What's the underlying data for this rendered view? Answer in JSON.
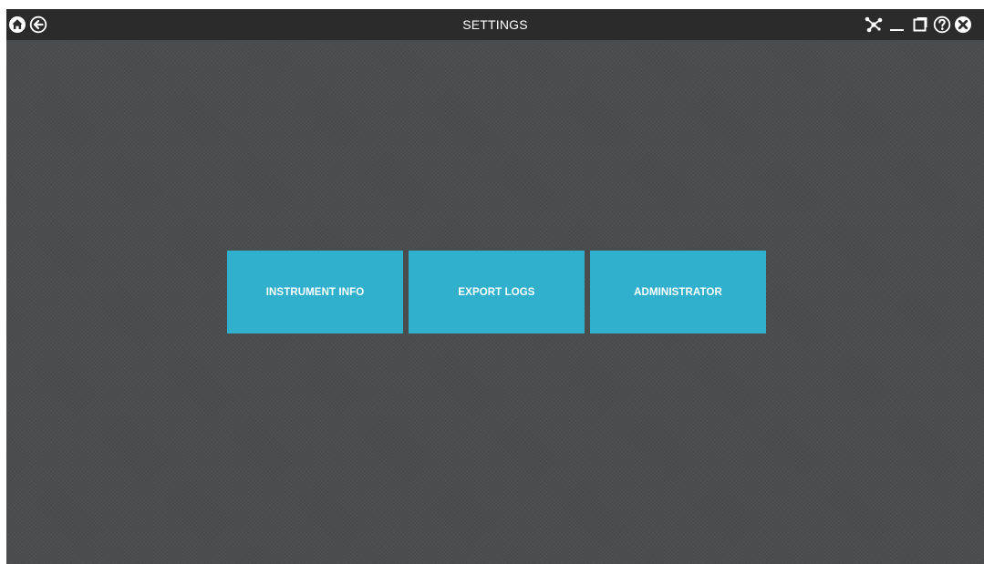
{
  "window": {
    "title": "SETTINGS"
  },
  "titlebar": {
    "left_icons": [
      "home-icon",
      "back-arrow-icon"
    ],
    "right_icons": [
      "network-icon",
      "minimize-icon",
      "restore-icon",
      "help-icon",
      "close-icon"
    ]
  },
  "tiles": [
    {
      "label": "INSTRUMENT INFO"
    },
    {
      "label": "EXPORT LOGS"
    },
    {
      "label": "ADMINISTRATOR"
    }
  ],
  "colors": {
    "background": "#4b4c4e",
    "titlebar": "#2b2b2b",
    "tile": "#31b0cd",
    "text": "#ffffff"
  }
}
